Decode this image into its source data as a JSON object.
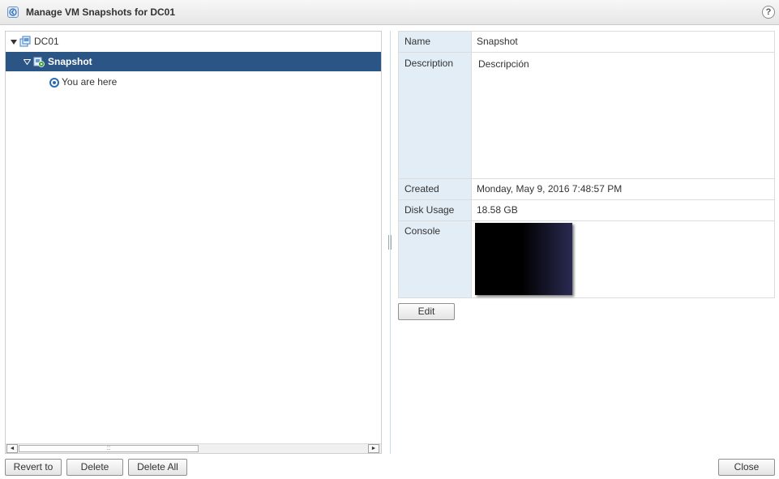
{
  "dialog": {
    "title": "Manage VM Snapshots for DC01",
    "title_icon": "back-arrow-icon",
    "help_label": "?"
  },
  "tree": {
    "nodes": [
      {
        "label": "DC01",
        "icon": "vm-icon",
        "expanded": true
      },
      {
        "label": "Snapshot",
        "icon": "snapshot-icon",
        "expanded": true,
        "selected": true
      },
      {
        "label": "You are here",
        "icon": "you-are-here-icon"
      }
    ],
    "scroll_left": "◄",
    "scroll_right": "►",
    "scroll_grip": "::"
  },
  "details": {
    "name_label": "Name",
    "name_value": "Snapshot",
    "description_label": "Description",
    "description_value": "Descripción",
    "created_label": "Created",
    "created_value": "Monday, May 9, 2016 7:48:57 PM",
    "disk_label": "Disk Usage",
    "disk_value": "18.58 GB",
    "console_label": "Console",
    "edit_label": "Edit"
  },
  "buttons": {
    "revert": "Revert to",
    "delete": "Delete",
    "delete_all": "Delete All",
    "close": "Close"
  },
  "colors": {
    "selection": "#2b5585",
    "label_column": "#e3edf5"
  }
}
